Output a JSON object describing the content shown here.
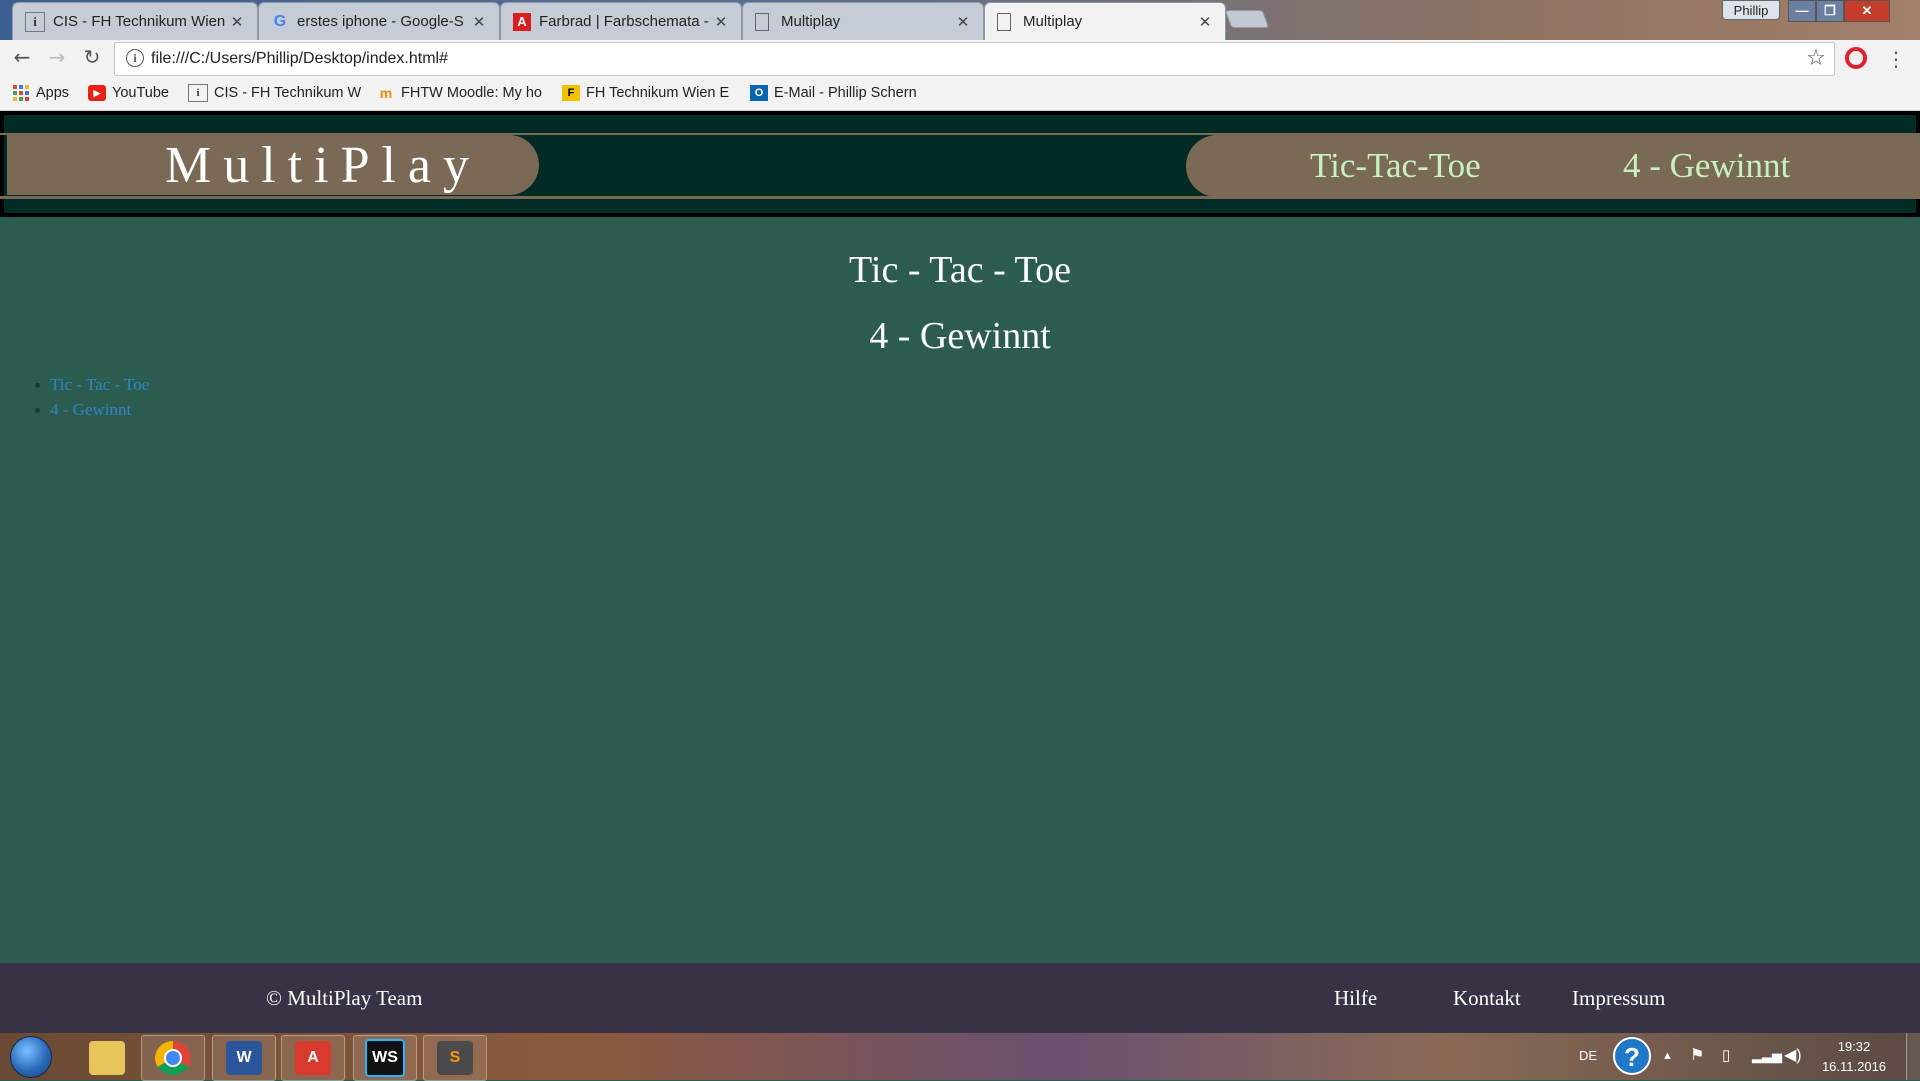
{
  "browser": {
    "tabs": [
      {
        "title": "CIS - FH Technikum Wien",
        "icon": "info-icon"
      },
      {
        "title": "erstes iphone - Google-S",
        "icon": "google-icon"
      },
      {
        "title": "Farbrad | Farbschemata -",
        "icon": "adobe-icon"
      },
      {
        "title": "Multiplay",
        "icon": "page-icon"
      },
      {
        "title": "Multiplay",
        "icon": "page-icon",
        "active": true
      }
    ],
    "profile": "Phillip",
    "url": "file:///C:/Users/Phillip/Desktop/index.html#",
    "bookmarks": [
      {
        "label": "Apps",
        "icon": "apps-grid-icon"
      },
      {
        "label": "YouTube",
        "icon": "youtube-icon"
      },
      {
        "label": "CIS - FH Technikum W",
        "icon": "info-icon"
      },
      {
        "label": "FHTW Moodle: My ho",
        "icon": "moodle-icon"
      },
      {
        "label": "FH Technikum Wien E",
        "icon": "f-icon"
      },
      {
        "label": "E-Mail - Phillip Schern",
        "icon": "outlook-icon"
      }
    ]
  },
  "site": {
    "logo": "MultiPlay",
    "nav": [
      "Tic-Tac-Toe",
      "4 - Gewinnt"
    ],
    "headings": [
      "Tic - Tac - Toe",
      "4 - Gewinnt"
    ],
    "links": [
      "Tic - Tac - Toe",
      "4 - Gewinnt"
    ],
    "footer": {
      "copyright": "© MultiPlay Team",
      "links": [
        "Hilfe",
        "Kontakt",
        "Impressum"
      ]
    },
    "colors": {
      "header_bg": "#022b26",
      "pill": "#7a6a55",
      "body_bg": "#2c5c4f",
      "footer_bg": "#373344",
      "nav_text": "#c8f0c0",
      "link": "#2e86c8"
    }
  },
  "taskbar": {
    "language": "DE",
    "time": "19:32",
    "date": "16.11.2016"
  }
}
